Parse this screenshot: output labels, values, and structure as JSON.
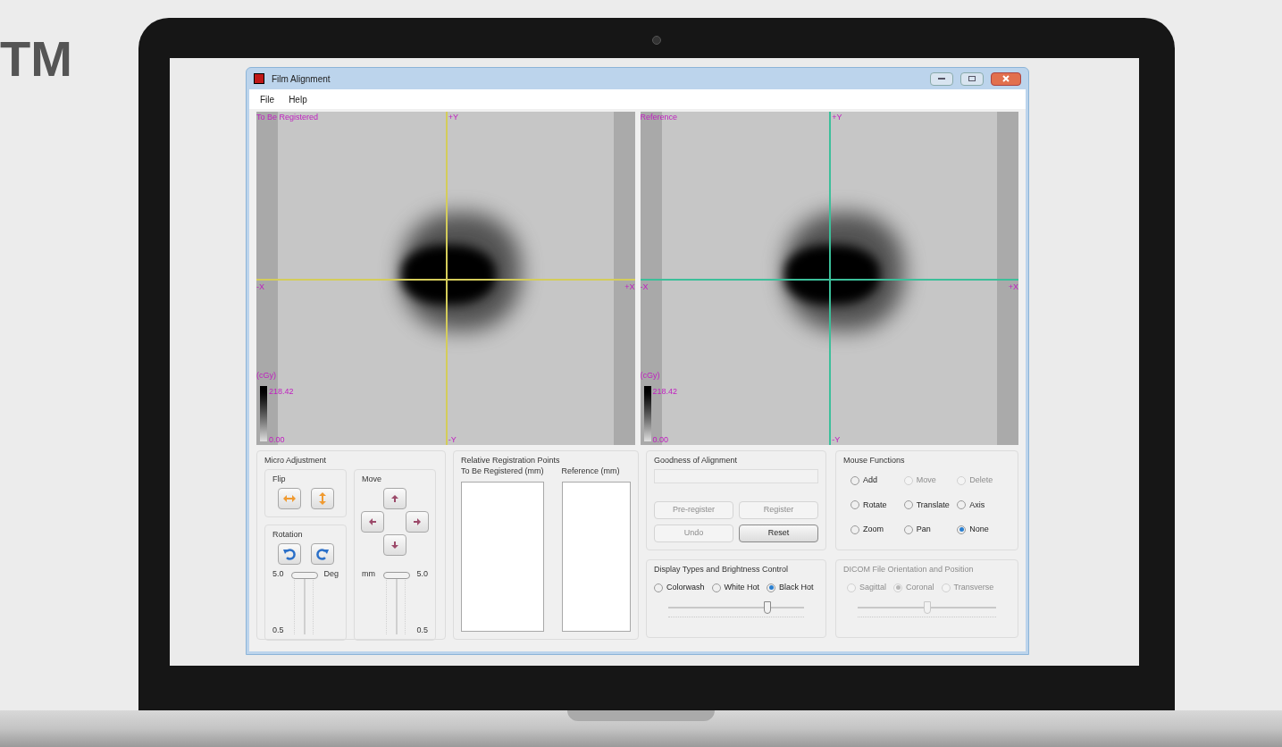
{
  "brand_text": "TM",
  "window": {
    "title": "Film Alignment"
  },
  "menu": [
    "File",
    "Help"
  ],
  "images": [
    {
      "label": "To Be Registered",
      "top_axis": "+Y",
      "bottom_axis": "-Y",
      "left_axis": "-X",
      "right_axis": "+X",
      "unit": "(cGy)",
      "max": "218.42",
      "min": "0.00",
      "color": "#d4cc5a"
    },
    {
      "label": "Reference",
      "top_axis": "+Y",
      "bottom_axis": "-Y",
      "left_axis": "-X",
      "right_axis": "+X",
      "unit": "(cGy)",
      "max": "218.42",
      "min": "0.00",
      "color": "#3cbf9a"
    }
  ],
  "micro_adjustment": {
    "title": "Micro Adjustment",
    "flip": {
      "title": "Flip"
    },
    "rotation": {
      "title": "Rotation",
      "max": "5.0",
      "unit": "Deg",
      "min": "0.5",
      "level": 0.95
    },
    "move": {
      "title": "Move",
      "unit": "mm",
      "max": "5.0",
      "min": "0.5",
      "level": 0.95
    }
  },
  "registration_points": {
    "title": "Relative Registration Points",
    "columns": [
      "To Be Registered (mm)",
      "Reference (mm)"
    ]
  },
  "goodness": {
    "title": "Goodness of Alignment",
    "buttons": [
      {
        "label": "Pre-register",
        "disabled": true
      },
      {
        "label": "Register",
        "disabled": true
      },
      {
        "label": "Undo",
        "disabled": true
      },
      {
        "label": "Reset",
        "disabled": false
      }
    ]
  },
  "mouse_functions": {
    "title": "Mouse Functions",
    "options": [
      {
        "label": "Add",
        "selected": false,
        "disabled": false
      },
      {
        "label": "Move",
        "selected": false,
        "disabled": true
      },
      {
        "label": "Delete",
        "selected": false,
        "disabled": true
      },
      {
        "label": "Rotate",
        "selected": false,
        "disabled": false
      },
      {
        "label": "Translate",
        "selected": false,
        "disabled": false
      },
      {
        "label": "Axis",
        "selected": false,
        "disabled": false
      },
      {
        "label": "Zoom",
        "selected": false,
        "disabled": false
      },
      {
        "label": "Pan",
        "selected": false,
        "disabled": false
      },
      {
        "label": "None",
        "selected": true,
        "disabled": false
      }
    ]
  },
  "display": {
    "title": "Display Types and Brightness Control",
    "disabled": false,
    "options": [
      {
        "label": "Colorwash",
        "selected": false
      },
      {
        "label": "White Hot",
        "selected": false
      },
      {
        "label": "Black Hot",
        "selected": true
      }
    ],
    "level": 0.73
  },
  "dicom": {
    "title": "DICOM File Orientation and Position",
    "disabled": true,
    "options": [
      {
        "label": "Sagittal",
        "selected": false
      },
      {
        "label": "Coronal",
        "selected": true
      },
      {
        "label": "Transverse",
        "selected": false
      }
    ],
    "level": 0.5
  }
}
